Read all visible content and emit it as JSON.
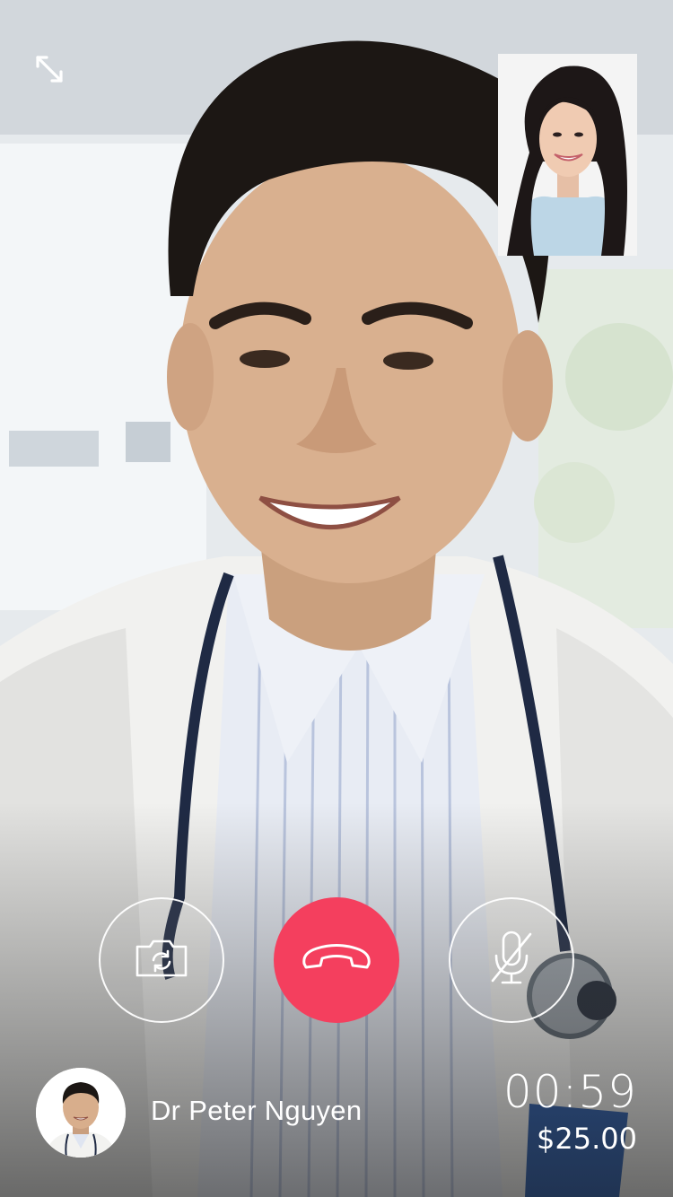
{
  "call": {
    "participant_name": "Dr Peter Nguyen",
    "duration": "00:59",
    "cost": "$25.00"
  },
  "icons": {
    "expand": "expand-arrows-icon",
    "switch_camera": "switch-camera-icon",
    "end_call": "phone-hangup-icon",
    "mute": "microphone-muted-icon"
  },
  "colors": {
    "end_call": "#f43f5e",
    "text": "#ffffff"
  }
}
